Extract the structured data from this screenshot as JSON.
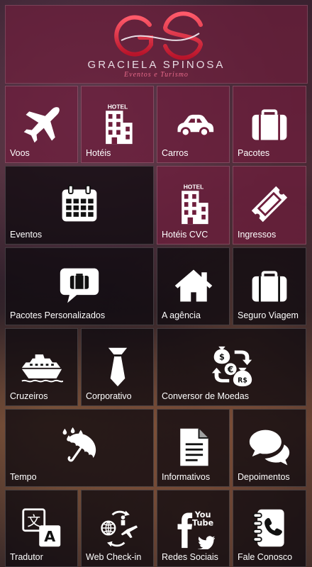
{
  "brand": {
    "name": "GRACIELA SPINOSA",
    "subtitle": "Eventos e Turismo",
    "colors": {
      "primary": "#6e1e3c",
      "accent": "#e8344a"
    }
  },
  "tiles": [
    {
      "label": "Voos",
      "icon": "airplane-icon"
    },
    {
      "label": "Hotéis",
      "icon": "hotel-icon",
      "icon_text": "HOTEL"
    },
    {
      "label": "Carros",
      "icon": "car-icon"
    },
    {
      "label": "Pacotes",
      "icon": "suitcase-icon"
    },
    {
      "label": "Eventos",
      "icon": "calendar-icon"
    },
    {
      "label": "Hotéis CVC",
      "icon": "hotel-icon",
      "icon_text": "HOTEL"
    },
    {
      "label": "Ingressos",
      "icon": "ticket-icon"
    },
    {
      "label": "Pacotes Personalizados",
      "icon": "suitcase-speech-icon"
    },
    {
      "label": "A agência",
      "icon": "home-icon"
    },
    {
      "label": "Seguro Viagem",
      "icon": "suitcase-icon"
    },
    {
      "label": "Cruzeiros",
      "icon": "cruise-ship-icon"
    },
    {
      "label": "Corporativo",
      "icon": "necktie-icon"
    },
    {
      "label": "Conversor de Moedas",
      "icon": "currency-exchange-icon",
      "icon_text": [
        "€",
        "R$"
      ]
    },
    {
      "label": "Tempo",
      "icon": "umbrella-rain-icon"
    },
    {
      "label": "Informativos",
      "icon": "document-icon"
    },
    {
      "label": "Depoimentos",
      "icon": "chat-bubbles-icon"
    },
    {
      "label": "Tradutor",
      "icon": "translate-icon",
      "icon_text": [
        "文",
        "A"
      ]
    },
    {
      "label": "Web Check-in",
      "icon": "web-checkin-icon"
    },
    {
      "label": "Redes Sociais",
      "icon": "social-media-icon",
      "icon_text": [
        "You",
        "Tube"
      ]
    },
    {
      "label": "Fale Conosco",
      "icon": "address-book-icon"
    }
  ]
}
